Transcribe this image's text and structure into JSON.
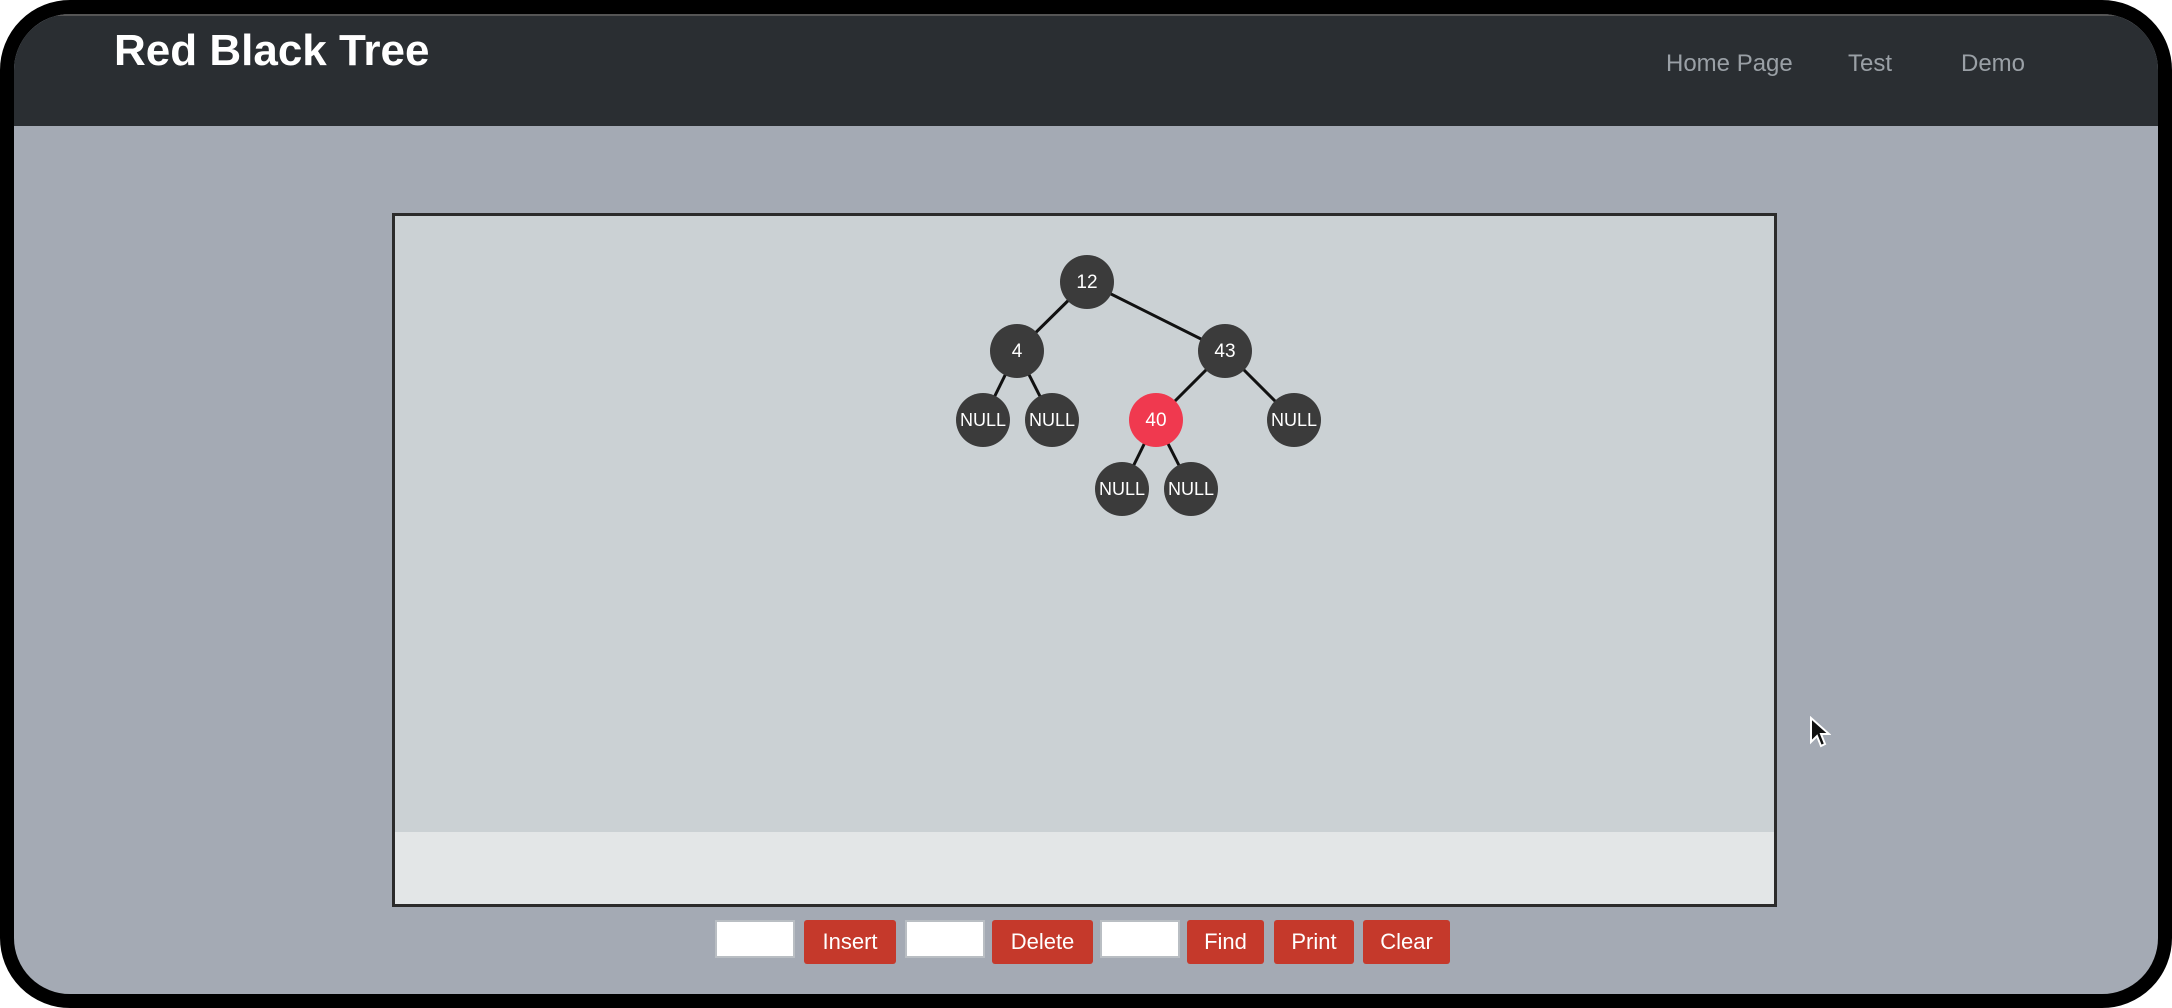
{
  "header": {
    "title": "Red Black Tree",
    "nav": [
      "Home Page",
      "Test",
      "Demo"
    ]
  },
  "tree": {
    "nodes": [
      {
        "id": "n12",
        "label": "12",
        "color": "black"
      },
      {
        "id": "n4",
        "label": "4",
        "color": "black"
      },
      {
        "id": "n43",
        "label": "43",
        "color": "black"
      },
      {
        "id": "n4L",
        "label": "NULL",
        "color": "black"
      },
      {
        "id": "n4R",
        "label": "NULL",
        "color": "black"
      },
      {
        "id": "n40",
        "label": "40",
        "color": "red"
      },
      {
        "id": "n43R",
        "label": "NULL",
        "color": "black"
      },
      {
        "id": "n40L",
        "label": "NULL",
        "color": "black"
      },
      {
        "id": "n40R",
        "label": "NULL",
        "color": "black"
      }
    ],
    "edges": [
      [
        "n12",
        "n4"
      ],
      [
        "n12",
        "n43"
      ],
      [
        "n4",
        "n4L"
      ],
      [
        "n4",
        "n4R"
      ],
      [
        "n43",
        "n40"
      ],
      [
        "n43",
        "n43R"
      ],
      [
        "n40",
        "n40L"
      ],
      [
        "n40",
        "n40R"
      ]
    ]
  },
  "controls": {
    "insert_value": "",
    "delete_value": "",
    "find_value": "",
    "insert_label": "Insert",
    "delete_label": "Delete",
    "find_label": "Find",
    "print_label": "Print",
    "clear_label": "Clear"
  },
  "colors": {
    "black_node": "#3b3b3b",
    "red_node": "#f0394f",
    "edge": "#111111",
    "button": "#c5392b"
  }
}
